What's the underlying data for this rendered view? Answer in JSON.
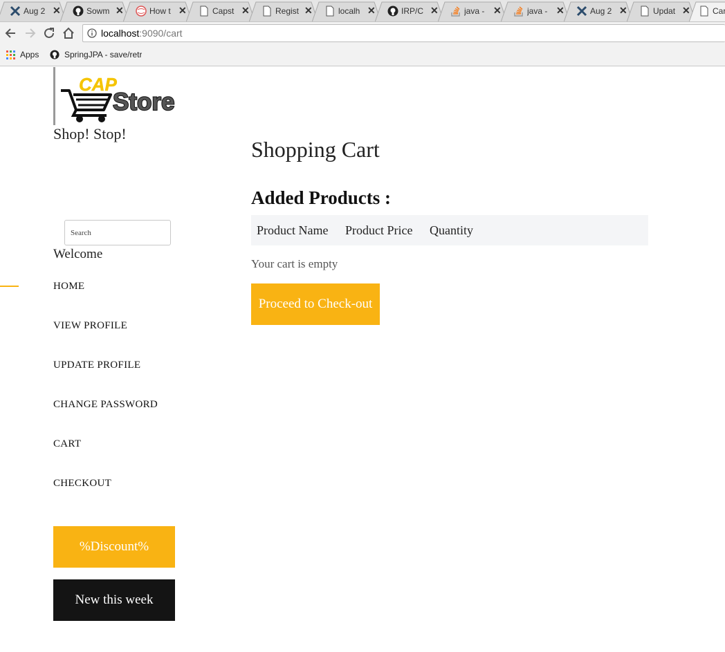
{
  "browser": {
    "tabs": [
      {
        "title": "Aug 2",
        "icon": "x-logo-icon"
      },
      {
        "title": "Sowm",
        "icon": "github-icon"
      },
      {
        "title": "How t",
        "icon": "globe-icon"
      },
      {
        "title": "Capst",
        "icon": "page-icon"
      },
      {
        "title": "Regist",
        "icon": "page-icon"
      },
      {
        "title": "localh",
        "icon": "page-icon"
      },
      {
        "title": "IRP/C",
        "icon": "github-icon"
      },
      {
        "title": "java -",
        "icon": "stackoverflow-icon"
      },
      {
        "title": "java -",
        "icon": "stackoverflow-icon"
      },
      {
        "title": "Aug 2",
        "icon": "x-logo-icon"
      },
      {
        "title": "Updat",
        "icon": "page-icon"
      },
      {
        "title": "Car",
        "icon": "page-icon",
        "active": true
      }
    ],
    "url_host": "localhost",
    "url_path": ":9090/cart",
    "bookmarks": [
      {
        "label": "Apps",
        "icon": "apps-grid-icon"
      },
      {
        "label": "SpringJPA - save/retr",
        "icon": "github-icon"
      }
    ]
  },
  "sidebar": {
    "tagline": "Shop! Stop!",
    "search_placeholder": "Search",
    "welcome": "Welcome",
    "nav": [
      "HOME",
      "VIEW PROFILE",
      "UPDATE PROFILE",
      "CHANGE PASSWORD",
      "CART",
      "CHECKOUT"
    ],
    "discount_label": "%Discount%",
    "new_label": "New this week"
  },
  "main": {
    "title": "Shopping Cart",
    "subtitle": "Added Products :",
    "columns": [
      "Product Name",
      "Product Price",
      "Quantity"
    ],
    "empty_message": "Your cart is empty",
    "checkout_label": "Proceed to Check-out"
  },
  "colors": {
    "accent": "#f9b313",
    "dark": "#141414",
    "table_bg": "#f4f5f7"
  }
}
